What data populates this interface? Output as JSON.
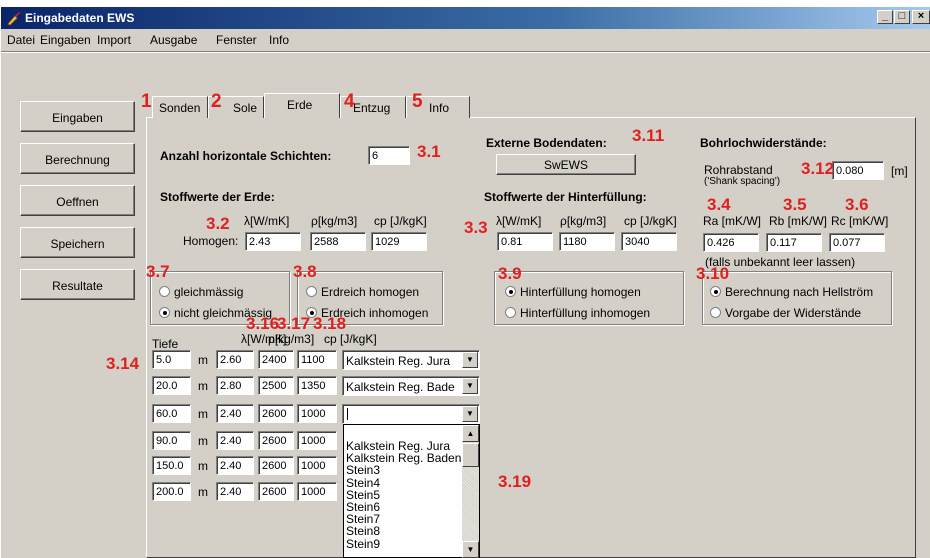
{
  "window": {
    "title": "Eingabedaten EWS",
    "min": "_",
    "max": "□",
    "close": "×"
  },
  "menu": [
    "Datei",
    "Eingaben",
    "Import",
    "Ausgabe",
    "Fenster",
    "Info"
  ],
  "left_buttons": [
    "Eingaben",
    "Berechnung",
    "Oeffnen",
    "Speichern",
    "Resultate"
  ],
  "tabs": [
    {
      "num": "1",
      "label": "Sonden"
    },
    {
      "num": "2",
      "label": "Sole"
    },
    {
      "num": "3",
      "label": "Erde"
    },
    {
      "num": "4",
      "label": "Entzug"
    },
    {
      "num": "5",
      "label": "Info"
    }
  ],
  "layers": {
    "label": "Anzahl horizontale Schichten:",
    "value": "6",
    "marker": "3.1"
  },
  "external": {
    "label": "Externe Bodendaten:",
    "marker": "3.11",
    "button": "SwEWS"
  },
  "borehole": {
    "label": "Bohrlochwiderstände:",
    "spacing_label": "Rohrabstand",
    "spacing_sub": "('Shank spacing')",
    "spacing_value": "0.080",
    "spacing_unit": "[m]",
    "marker": "3.12",
    "headers": [
      "Ra [mK/W]",
      "Rb [mK/W]",
      "Rc [mK/W]"
    ],
    "markers": [
      "3.4",
      "3.5",
      "3.6"
    ],
    "values": [
      "0.426",
      "0.117",
      "0.077"
    ],
    "note": "(falls unbekannt leer lassen)"
  },
  "soil": {
    "label": "Stoffwerte der Erde:",
    "marker": "3.2",
    "row_label": "Homogen:",
    "headers": [
      "λ[W/mK]",
      "ρ[kg/m3]",
      "cp [J/kgK]"
    ],
    "values": [
      "2.43",
      "2588",
      "1029"
    ]
  },
  "backfill": {
    "label": "Stoffwerte der Hinterfüllung:",
    "marker": "3.3",
    "headers": [
      "λ[W/mK]",
      "ρ[kg/m3]",
      "cp [J/kgK]"
    ],
    "values": [
      "0.81",
      "1180",
      "3040"
    ]
  },
  "group37": {
    "marker": "3.7",
    "options": [
      "gleichmässig",
      "nicht gleichmässig"
    ],
    "selected": 1
  },
  "group38": {
    "marker": "3.8",
    "options": [
      "Erdreich homogen",
      "Erdreich inhomogen"
    ],
    "selected": 1
  },
  "group39": {
    "marker": "3.9",
    "options": [
      "Hinterfüllung homogen",
      "Hinterfüllung inhomogen"
    ],
    "selected": 0
  },
  "group310": {
    "marker": "3.10",
    "options": [
      "Berechnung nach Hellström",
      "Vorgabe der Widerstände"
    ],
    "selected": 0
  },
  "table": {
    "markers": [
      "3.16",
      "3.17",
      "3.18"
    ],
    "row_marker": "3.14",
    "header_depth": "Tiefe",
    "headers": [
      "λ[W/mK]",
      "ρ[kg/m3]",
      "cp [J/kgK]"
    ],
    "unit": "m",
    "rows": [
      {
        "depth": "5.0",
        "lambda": "2.60",
        "rho": "2400",
        "cp": "1100",
        "material": "Kalkstein Reg. Jura"
      },
      {
        "depth": "20.0",
        "lambda": "2.80",
        "rho": "2500",
        "cp": "1350",
        "material": "Kalkstein Reg. Bade"
      },
      {
        "depth": "60.0",
        "lambda": "2.40",
        "rho": "2600",
        "cp": "1000",
        "material": ""
      },
      {
        "depth": "90.0",
        "lambda": "2.40",
        "rho": "2600",
        "cp": "1000",
        "material": ""
      },
      {
        "depth": "150.0",
        "lambda": "2.40",
        "rho": "2600",
        "cp": "1000",
        "material": ""
      },
      {
        "depth": "200.0",
        "lambda": "2.40",
        "rho": "2600",
        "cp": "1000",
        "material": ""
      }
    ]
  },
  "dropdown": {
    "marker": "3.19",
    "items": [
      "Kalkstein Reg. Jura",
      "Kalkstein Reg. Baden",
      "Stein3",
      "Stein4",
      "Stein5",
      "Stein6",
      "Stein7",
      "Stein8",
      "Stein9"
    ]
  }
}
